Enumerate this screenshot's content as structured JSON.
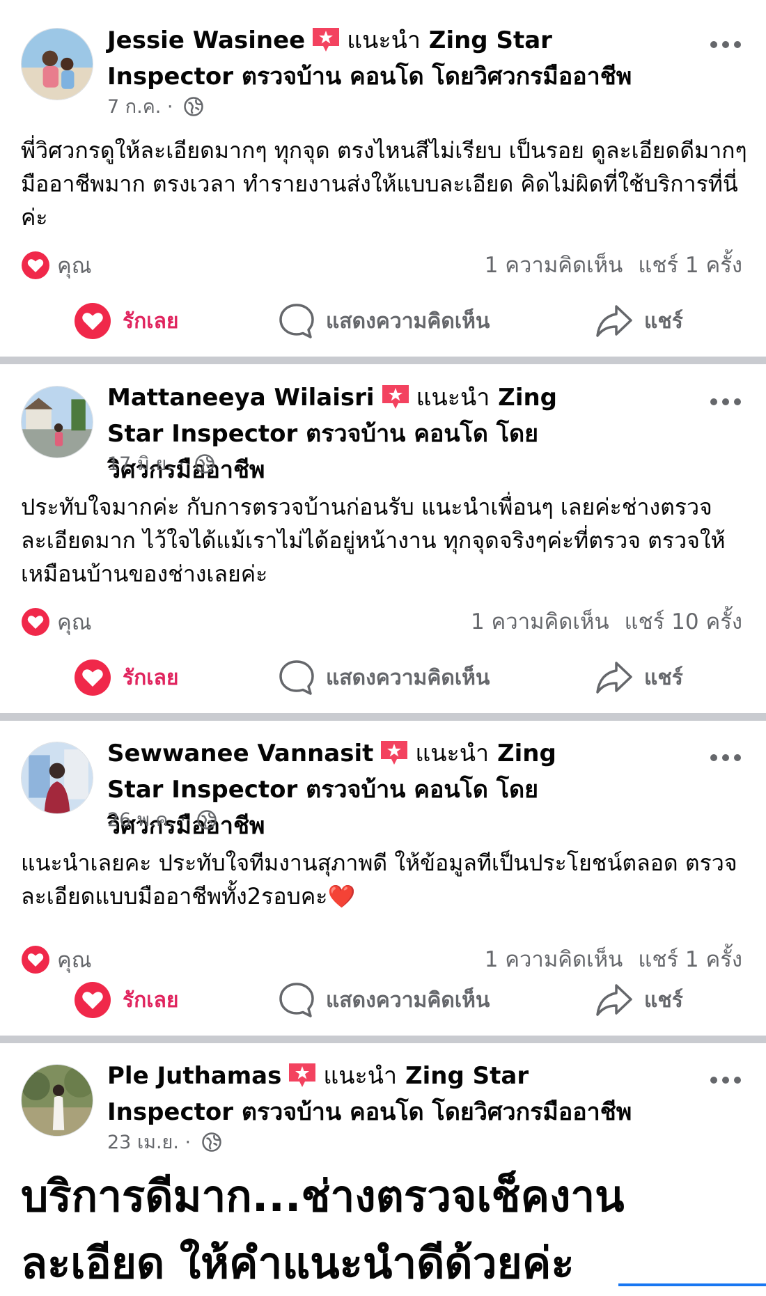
{
  "posts": [
    {
      "author": "Jessie Wasinee",
      "recommend": "แนะนำ",
      "page": "Zing Star Inspector ตรวจบ้าน คอนโด โดยวิศวกรมืออาชีพ",
      "date": "7 ก.ค.",
      "body": "พี่วิศวกรดูให้ละเอียดมากๆ ทุกจุด ตรงไหนสีไม่เรียบ เป็นรอย ดูละเอียดดีมากๆ มืออาชีพมาก ตรงเวลา ทำรายงานส่งให้แบบละเอียด คิดไม่ผิดที่ใช้บริการที่นี่ค่ะ",
      "reaction_label": "คุณ",
      "comments": "1 ความคิดเห็น",
      "shares": "แชร์ 1 ครั้ง"
    },
    {
      "author": "Mattaneeya Wilaisri",
      "recommend": "แนะนำ",
      "page": "Zing Star Inspector ตรวจบ้าน คอนโด โดยวิศวกรมืออาชีพ",
      "date": "17 มิ.ย.",
      "body": "ประทับใจมากค่ะ กับการตรวจบ้านก่อนรับ แนะนำเพื่อนๆ เลยค่ะช่างตรวจละเอียดมาก ไว้ใจได้แม้เราไม่ได้อยู่หน้างาน ทุกจุดจริงๆค่ะที่ตรวจ ตรวจให้เหมือนบ้านของช่างเลยค่ะ",
      "reaction_label": "คุณ",
      "comments": "1 ความคิดเห็น",
      "shares": "แชร์ 10 ครั้ง"
    },
    {
      "author": "Sewwanee Vannasit",
      "recommend": "แนะนำ",
      "page": "Zing Star Inspector ตรวจบ้าน คอนโด โดยวิศวกรมืออาชีพ",
      "date": "26 พ.ค.",
      "body": "แนะนำเลยคะ ประทับใจทีมงานสุภาพดี ให้ข้อมูลทีเป็นประโยชน์ตลอด ตรวจละเอียดแบบมืออาชีพทั้ง2รอบคะ❤️",
      "reaction_label": "คุณ",
      "comments": "1 ความคิดเห็น",
      "shares": "แชร์ 1 ครั้ง"
    },
    {
      "author": "Ple Juthamas",
      "recommend": "แนะนำ",
      "page": "Zing Star Inspector ตรวจบ้าน คอนโด โดยวิศวกรมืออาชีพ",
      "date": "23 เม.ย.",
      "body_large_line1": "บริการดีมาก...ช่างตรวจเช็คงาน",
      "body_large_line2": "ละเอียด  ให้คำแนะนำดีด้วยค่ะ"
    }
  ],
  "actions": {
    "love": "รักเลย",
    "comment": "แสดงความคิดเห็น",
    "share": "แชร์"
  },
  "colors": {
    "love_red": "#e0245e",
    "divider": "#c9cbd0",
    "secondary_text": "#65676b",
    "accent_blue": "#1877f2"
  },
  "icons": [
    "recommend-star-icon",
    "globe-icon",
    "more-icon",
    "heart-icon",
    "comment-icon",
    "share-arrow-icon"
  ]
}
